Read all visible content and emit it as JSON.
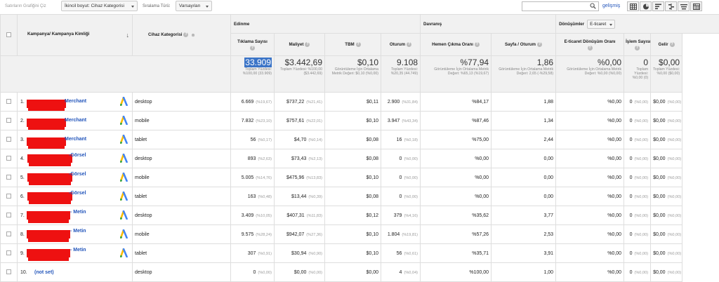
{
  "toolbar": {
    "secondary_plot_label": "Satırların Grafiğini Çiz",
    "secondary_dim_select": "İkincil boyut: Cihaz Kategorisi",
    "sort_label": "Sıralama Türü:",
    "sort_select": "Varsayılan",
    "search_value": "",
    "advanced_link": "gelişmiş"
  },
  "headers": {
    "campaign": "Kampanya/ Kampanya Kimliği",
    "device": "Cihaz Kategorisi",
    "group_acquisition": "Edinme",
    "group_behavior": "Davranış",
    "group_conversions": "Dönüşümler",
    "conversions_select": "E-ticaret",
    "clicks": "Tıklama Sayısı",
    "cost": "Maliyet",
    "cpc": "TBM",
    "sessions": "Oturum",
    "bounce": "Hemen Çıkma Oranı",
    "pages_per_session": "Sayfa / Oturum",
    "ecom_rate": "E-ticaret Dönüşüm Oranı",
    "transactions": "İşlem Sayısı",
    "revenue": "Gelir"
  },
  "totals": {
    "clicks": {
      "big": "33.909",
      "sub": "Toplam Yüzdesi: %100,00 (33.909)"
    },
    "cost": {
      "big": "$3.442,69",
      "sub": "Toplam Yüzdesi: %100,00 ($3.442,69)"
    },
    "cpc": {
      "big": "$0,10",
      "sub": "Görüntüleme İçin Ortalama Metrik Değeri: $0,10 (%0,00)"
    },
    "sessions": {
      "big": "9.108",
      "sub": "Toplam Yüzdesi: %20,35 (44.749)"
    },
    "bounce": {
      "big": "%77,94",
      "sub": "Görüntüleme İçin Ortalama Metrik Değeri: %65,13 (%19,67)"
    },
    "pages": {
      "big": "1,86",
      "sub": "Görüntüleme İçin Ortalama Metrik Değeri: 2,65 (-%29,58)"
    },
    "ecom": {
      "big": "%0,00",
      "sub": "Görüntüleme İçin Ortalama Metrik Değeri: %0,00 (%0,00)"
    },
    "trans": {
      "big": "0",
      "sub": "Toplam Yüzdesi: %0,00 (0)"
    },
    "revenue": {
      "big": "$0,00",
      "sub": "Toplam Yüzdesi: %0,00 ($0,00)"
    }
  },
  "rows": [
    {
      "num": "1.",
      "campaign": "Merchant",
      "device": "desktop",
      "clicks": "6.669",
      "clicks_pct": "(%19,67)",
      "cost": "$737,22",
      "cost_pct": "(%21,41)",
      "cpc": "$0,11",
      "sessions": "2.900",
      "sessions_pct": "(%31,84)",
      "bounce": "%84,17",
      "pages": "1,88",
      "ecom": "%0,00",
      "trans": "0",
      "trans_pct": "(%0,00)",
      "revenue": "$0,00",
      "revenue_pct": "(%0,00)"
    },
    {
      "num": "2.",
      "campaign": "Merchant",
      "device": "mobile",
      "clicks": "7.832",
      "clicks_pct": "(%23,10)",
      "cost": "$757,61",
      "cost_pct": "(%22,01)",
      "cpc": "$0,10",
      "sessions": "3.947",
      "sessions_pct": "(%43,34)",
      "bounce": "%87,46",
      "pages": "1,34",
      "ecom": "%0,00",
      "trans": "0",
      "trans_pct": "(%0,00)",
      "revenue": "$0,00",
      "revenue_pct": "(%0,00)"
    },
    {
      "num": "3.",
      "campaign": "Merchant",
      "device": "tablet",
      "clicks": "56",
      "clicks_pct": "(%0,17)",
      "cost": "$4,70",
      "cost_pct": "(%0,14)",
      "cpc": "$0,08",
      "sessions": "16",
      "sessions_pct": "(%0,18)",
      "bounce": "%75,00",
      "pages": "2,44",
      "ecom": "%0,00",
      "trans": "0",
      "trans_pct": "(%0,00)",
      "revenue": "$0,00",
      "revenue_pct": "(%0,00)"
    },
    {
      "num": "4.",
      "campaign": "-Görsel",
      "device": "desktop",
      "clicks": "893",
      "clicks_pct": "(%2,63)",
      "cost": "$73,43",
      "cost_pct": "(%2,13)",
      "cpc": "$0,08",
      "sessions": "0",
      "sessions_pct": "(%0,00)",
      "bounce": "%0,00",
      "pages": "0,00",
      "ecom": "%0,00",
      "trans": "0",
      "trans_pct": "(%0,00)",
      "revenue": "$0,00",
      "revenue_pct": "(%0,00)"
    },
    {
      "num": "5.",
      "campaign": "-Görsel",
      "device": "mobile",
      "clicks": "5.005",
      "clicks_pct": "(%14,76)",
      "cost": "$475,96",
      "cost_pct": "(%13,83)",
      "cpc": "$0,10",
      "sessions": "0",
      "sessions_pct": "(%0,00)",
      "bounce": "%0,00",
      "pages": "0,00",
      "ecom": "%0,00",
      "trans": "0",
      "trans_pct": "(%0,00)",
      "revenue": "$0,00",
      "revenue_pct": "(%0,00)"
    },
    {
      "num": "6.",
      "campaign": "-Görsel",
      "device": "tablet",
      "clicks": "163",
      "clicks_pct": "(%0,48)",
      "cost": "$13,44",
      "cost_pct": "(%0,39)",
      "cpc": "$0,08",
      "sessions": "0",
      "sessions_pct": "(%0,00)",
      "bounce": "%0,00",
      "pages": "0,00",
      "ecom": "%0,00",
      "trans": "0",
      "trans_pct": "(%0,00)",
      "revenue": "$0,00",
      "revenue_pct": "(%0,00)"
    },
    {
      "num": "7.",
      "campaign": "- Metin",
      "device": "desktop",
      "clicks": "3.409",
      "clicks_pct": "(%10,05)",
      "cost": "$407,31",
      "cost_pct": "(%11,83)",
      "cpc": "$0,12",
      "sessions": "379",
      "sessions_pct": "(%4,16)",
      "bounce": "%35,62",
      "pages": "3,77",
      "ecom": "%0,00",
      "trans": "0",
      "trans_pct": "(%0,00)",
      "revenue": "$0,00",
      "revenue_pct": "(%0,00)"
    },
    {
      "num": "8.",
      "campaign": "- Metin",
      "device": "mobile",
      "clicks": "9.575",
      "clicks_pct": "(%28,24)",
      "cost": "$942,07",
      "cost_pct": "(%27,36)",
      "cpc": "$0,10",
      "sessions": "1.804",
      "sessions_pct": "(%19,81)",
      "bounce": "%57,26",
      "pages": "2,53",
      "ecom": "%0,00",
      "trans": "0",
      "trans_pct": "(%0,00)",
      "revenue": "$0,00",
      "revenue_pct": "(%0,00)"
    },
    {
      "num": "9.",
      "campaign": "- Metin",
      "device": "tablet",
      "clicks": "307",
      "clicks_pct": "(%0,91)",
      "cost": "$30,94",
      "cost_pct": "(%0,90)",
      "cpc": "$0,10",
      "sessions": "56",
      "sessions_pct": "(%0,61)",
      "bounce": "%35,71",
      "pages": "3,91",
      "ecom": "%0,00",
      "trans": "0",
      "trans_pct": "(%0,00)",
      "revenue": "$0,00",
      "revenue_pct": "(%0,00)"
    },
    {
      "num": "10.",
      "campaign": "(not set)",
      "device": "desktop",
      "clicks": "0",
      "clicks_pct": "(%0,00)",
      "cost": "$0,00",
      "cost_pct": "(%0,00)",
      "cpc": "$0,00",
      "sessions": "4",
      "sessions_pct": "(%0,04)",
      "bounce": "%100,00",
      "pages": "1,00",
      "ecom": "%0,00",
      "trans": "0",
      "trans_pct": "(%0,00)",
      "revenue": "$0,00",
      "revenue_pct": "(%0,00)"
    }
  ],
  "colors": {
    "redaction": "#ee1111",
    "link": "#2255bb",
    "highlight": "#3b74c7",
    "header_bg": "#f1f1f1"
  },
  "icons": [
    "search-icon",
    "google-ads-icon",
    "help-icon",
    "table-view-icon",
    "pie-view-icon",
    "performance-view-icon",
    "comparison-view-icon",
    "pivot-view-icon"
  ]
}
